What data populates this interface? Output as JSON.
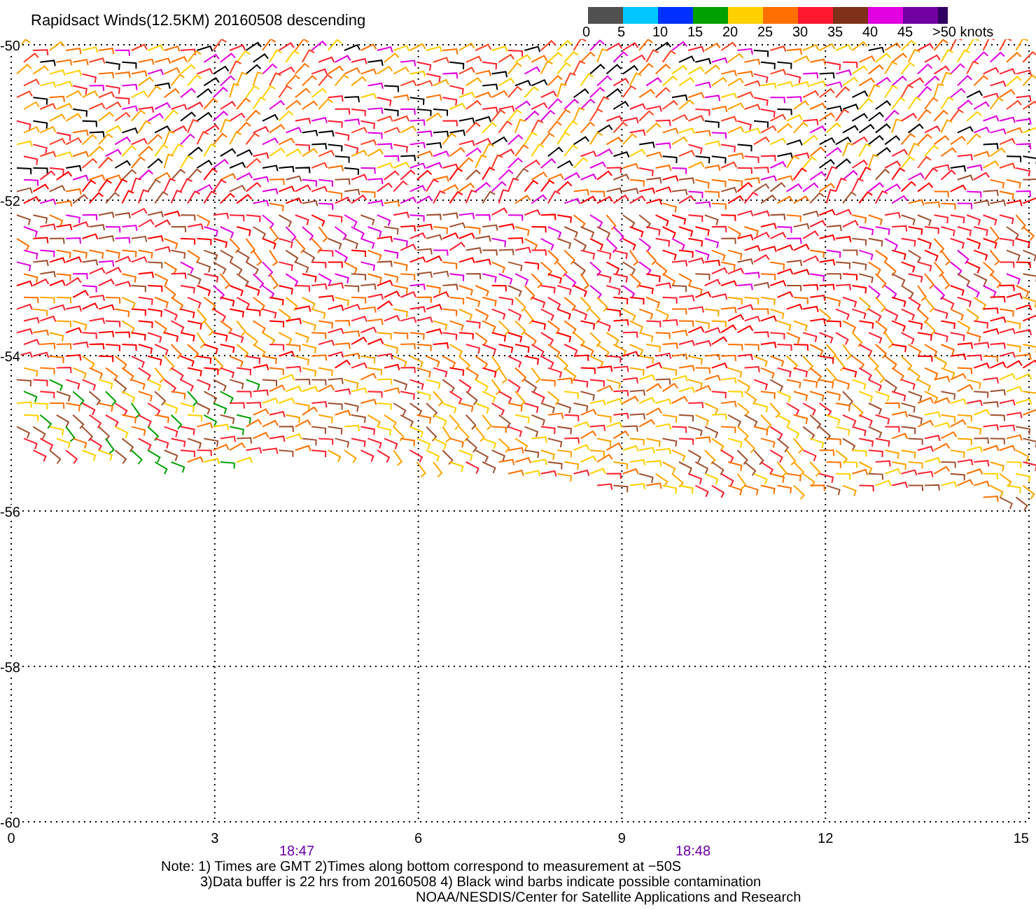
{
  "title": "Rapidsact Winds(12.5KM) 20160508 descending",
  "legend": {
    "segments": [
      {
        "color": "#505050"
      },
      {
        "color": "#00c8ff"
      },
      {
        "color": "#0030ff"
      },
      {
        "color": "#00a000"
      },
      {
        "color": "#ffd000"
      },
      {
        "color": "#ff7000"
      },
      {
        "color": "#ff1830"
      },
      {
        "color": "#803018"
      },
      {
        "color": "#e000e0"
      },
      {
        "color": "#7000a0"
      },
      {
        "color": "#300060"
      }
    ],
    "labels": [
      "0",
      "5",
      "10",
      "15",
      "20",
      "25",
      "30",
      "35",
      "40",
      "45",
      ">50 knots"
    ]
  },
  "plot": {
    "y_ticks": [
      "-50",
      "-52",
      "-54",
      "-56",
      "-58",
      "-60"
    ],
    "x_ticks": [
      "0",
      "3",
      "6",
      "9",
      "12",
      "15"
    ],
    "times": [
      "18:47",
      "18:48"
    ]
  },
  "notes": [
    "Note: 1) Times are GMT 2)Times along bottom correspond to measurement at −50S",
    "3)Data buffer is 22 hrs from 20160508 4) Black wind barbs indicate possible contamination",
    "NOAA/NESDIS/Center for Satellite Applications and Research"
  ]
}
